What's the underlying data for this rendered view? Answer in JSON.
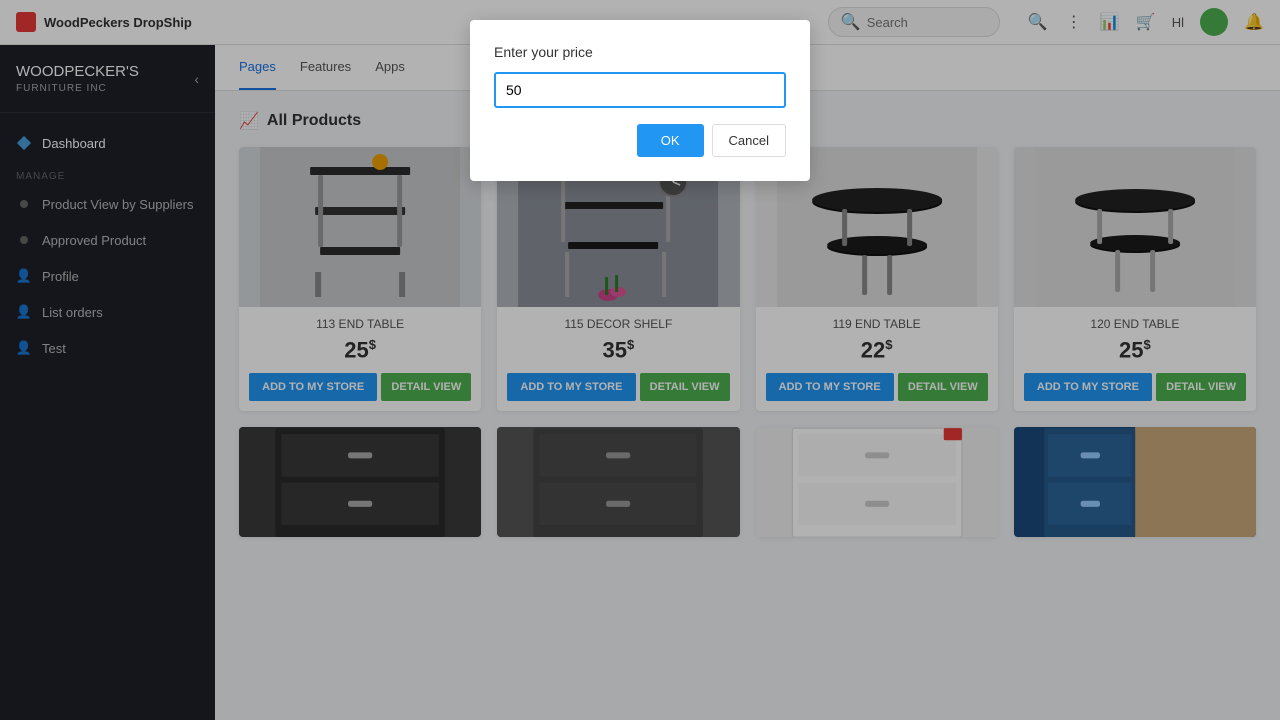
{
  "topbar": {
    "brand": "WoodPeckers DropShip",
    "search_placeholder": "Search",
    "hl_label": "Hl"
  },
  "sidebar": {
    "brand_line1": "WOODPECKER'S",
    "brand_line2": "FURNITURE INC",
    "items": [
      {
        "id": "dashboard",
        "label": "Dashboard",
        "icon": "diamond"
      },
      {
        "id": "product-view-suppliers",
        "label": "Product View by Suppliers",
        "icon": "dot"
      },
      {
        "id": "approved-product",
        "label": "Approved Product",
        "icon": "dot"
      },
      {
        "id": "profile",
        "label": "Profile",
        "icon": "person"
      },
      {
        "id": "list-orders",
        "label": "List orders",
        "icon": "person"
      },
      {
        "id": "test",
        "label": "Test",
        "icon": "person"
      }
    ],
    "section_label": "MANAGE"
  },
  "nav_tabs": [
    {
      "id": "pages",
      "label": "Pages",
      "active": true
    },
    {
      "id": "features",
      "label": "Features",
      "active": false
    },
    {
      "id": "apps",
      "label": "Apps",
      "active": false
    }
  ],
  "main": {
    "section_title": "All Products",
    "products": [
      {
        "id": "113-end-table",
        "name": "113 END TABLE",
        "price": "25",
        "currency": "$",
        "add_label": "ADD TO MY STORE",
        "detail_label": "DETAIL VIEW",
        "color": "#8899aa"
      },
      {
        "id": "115-decor-shelf",
        "name": "115 DECOR SHELF",
        "price": "35",
        "currency": "$",
        "add_label": "ADD TO MY STORE",
        "detail_label": "DETAIL VIEW",
        "color": "#7788aa"
      },
      {
        "id": "119-end-table",
        "name": "119 END TABLE",
        "price": "22",
        "currency": "$",
        "add_label": "ADD TO MY STORE",
        "detail_label": "DETAIL VIEW",
        "color": "#aabbcc"
      },
      {
        "id": "120-end-table",
        "name": "120 END TABLE",
        "price": "25",
        "currency": "$",
        "add_label": "ADD TO MY STORE",
        "detail_label": "DETAIL VIEW",
        "color": "#99aabb"
      }
    ],
    "partial_products": [
      {
        "id": "p1",
        "color": "#444"
      },
      {
        "id": "p2",
        "color": "#555"
      },
      {
        "id": "p3",
        "color": "#f0f0f0"
      },
      {
        "id": "p4",
        "color": "#336699"
      }
    ]
  },
  "modal": {
    "title": "Enter your price",
    "input_value": "50",
    "ok_label": "OK",
    "cancel_label": "Cancel"
  }
}
